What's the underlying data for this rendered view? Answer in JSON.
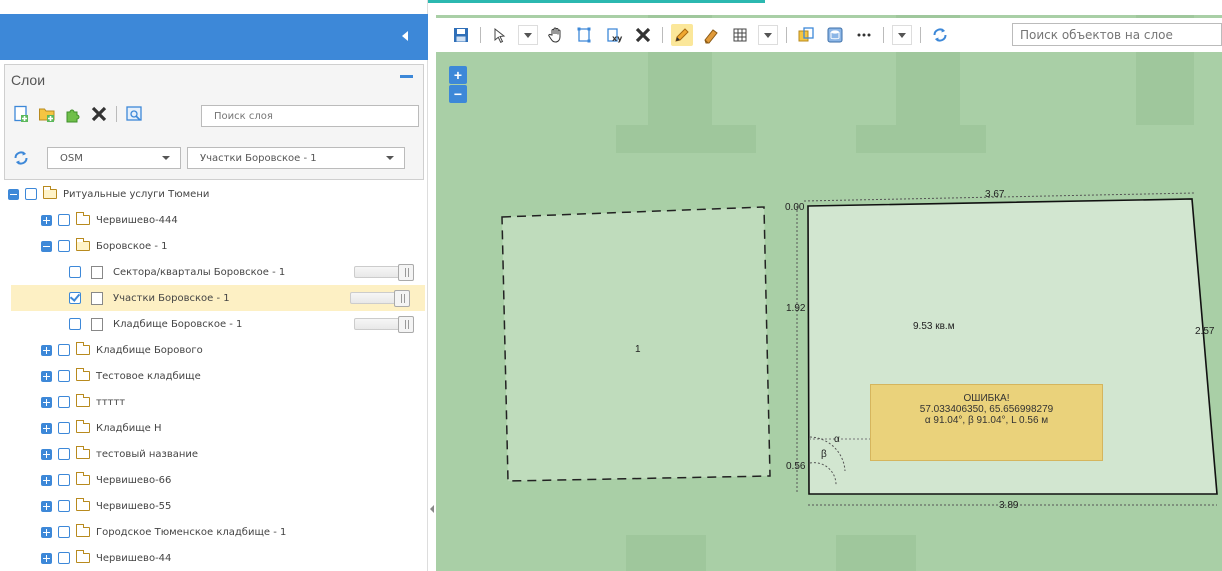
{
  "colors": {
    "accent": "#3d88d8",
    "highlight": "#fdf0c4",
    "error_fill": "#ead27b",
    "map_bg": "#a9cfa6"
  },
  "panel": {
    "title": "Слои",
    "search_placeholder": "Поиск слоя",
    "basemap_select": "OSM",
    "layer_select": "Участки Боровское - 1",
    "toolbar_icons": [
      "add-layer-icon",
      "add-group-icon",
      "puzzle-icon",
      "delete-icon",
      "properties-icon"
    ]
  },
  "tree": [
    {
      "label": "Ритуальные услуги Тюмени",
      "level": 0,
      "toggle": "minus",
      "type": "folder-open"
    },
    {
      "label": "Червишево-444",
      "level": 1,
      "toggle": "plus",
      "type": "folder"
    },
    {
      "label": "Боровское - 1",
      "level": 1,
      "toggle": "minus",
      "type": "folder-open"
    },
    {
      "label": "Сектора/кварталы Боровское - 1",
      "level": 2,
      "type": "layer",
      "checked": false
    },
    {
      "label": "Участки Боровское - 1",
      "level": 2,
      "type": "layer",
      "checked": true,
      "selected": true
    },
    {
      "label": "Кладбище Боровское - 1",
      "level": 2,
      "type": "layer",
      "checked": false
    },
    {
      "label": "Кладбище Борового",
      "level": 1,
      "toggle": "plus",
      "type": "folder"
    },
    {
      "label": "Тестовое кладбище",
      "level": 1,
      "toggle": "plus",
      "type": "folder"
    },
    {
      "label": "ттттт",
      "level": 1,
      "toggle": "plus",
      "type": "folder"
    },
    {
      "label": "Кладбище Н",
      "level": 1,
      "toggle": "plus",
      "type": "folder"
    },
    {
      "label": "тестовый название",
      "level": 1,
      "toggle": "plus",
      "type": "folder"
    },
    {
      "label": "Червишево-66",
      "level": 1,
      "toggle": "plus",
      "type": "folder"
    },
    {
      "label": "Червишево-55",
      "level": 1,
      "toggle": "plus",
      "type": "folder"
    },
    {
      "label": "Городское Тюменское кладбище - 1",
      "level": 1,
      "toggle": "plus",
      "type": "folder"
    },
    {
      "label": "Червишево-44",
      "level": 1,
      "toggle": "plus",
      "type": "folder"
    }
  ],
  "map": {
    "search_placeholder": "Поиск объектов на слое",
    "zoom_in": "+",
    "zoom_out": "−",
    "toolbar_icons": [
      "save-icon",
      "select-pointer-icon",
      "pan-hand-icon",
      "edit-vertices-icon",
      "coordinates-xy-icon",
      "delete-icon",
      "pencil-icon",
      "eraser-icon",
      "grid-icon",
      "split-icon",
      "database-icon",
      "more-icon",
      "refresh-icon"
    ],
    "polygon1_label": "1",
    "polygon2": {
      "area": "9.53 кв.м",
      "top_length": "3.67",
      "bottom_length": "3.89",
      "left_length": "1.92",
      "right_length": "2.57",
      "corner_top": "0.00",
      "corner_bottom": "0.56",
      "alpha": "α",
      "beta": "β"
    },
    "error": {
      "title": "ОШИБКА!",
      "coords": "57.033406350, 65.656998279",
      "details": "α 91.04°, β 91.04°, L 0.56 м"
    }
  }
}
